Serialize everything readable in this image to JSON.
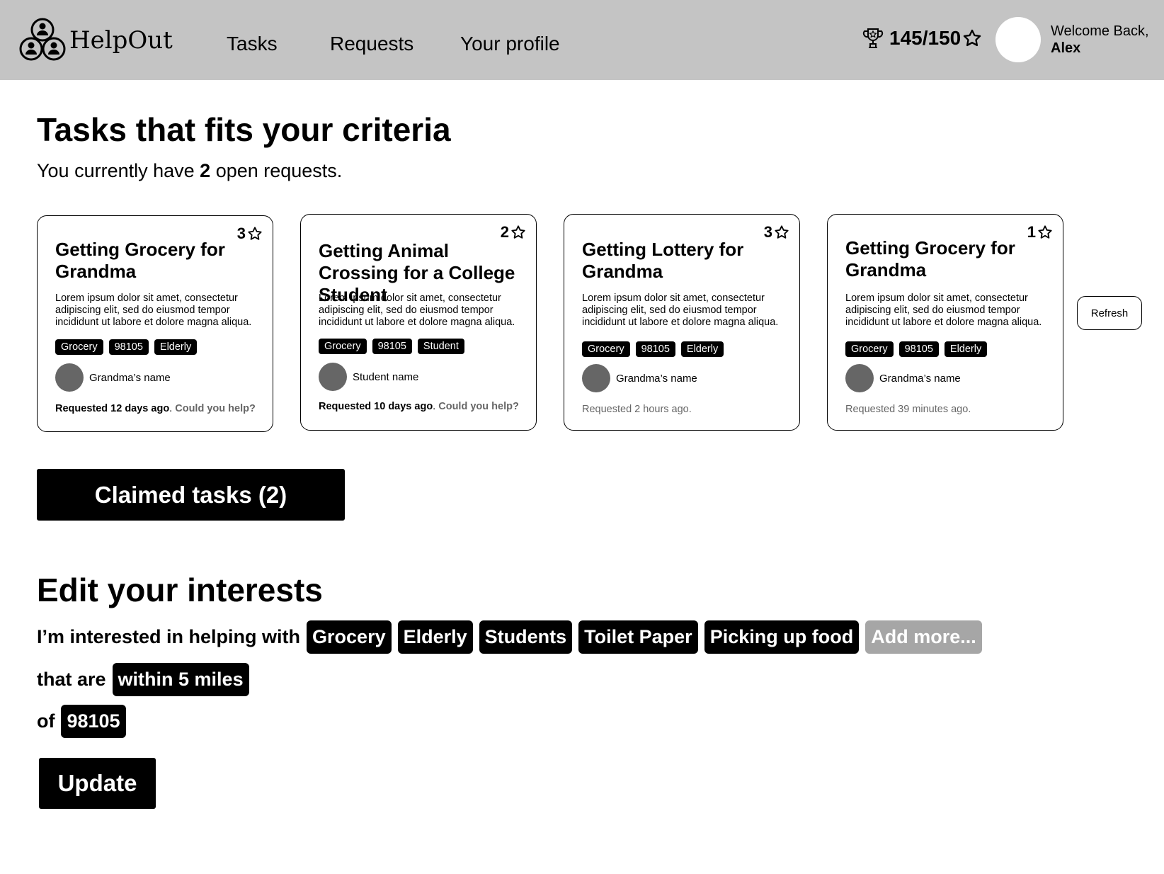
{
  "header": {
    "logo_text": "HelpOut",
    "nav": [
      "Tasks",
      "Requests",
      "Your profile"
    ],
    "score": "145/150",
    "welcome": "Welcome Back,",
    "user_name": "Alex"
  },
  "tasks": {
    "title": "Tasks that fits your criteria",
    "open_prefix": "You currently have ",
    "open_count": "2",
    "open_suffix": " open requests.",
    "cards": [
      {
        "stars": "3",
        "title": "Getting Grocery for Grandma",
        "desc": "Lorem ipsum dolor sit amet, consectetur adipiscing elit, sed do eiusmod tempor incididunt ut labore et dolore magna aliqua.",
        "tags": [
          "Grocery",
          "98105",
          "Elderly"
        ],
        "person": "Grandma’s name",
        "requested": "Requested 12 days ago",
        "help": "Could you help?"
      },
      {
        "stars": "2",
        "title": "Getting Animal Crossing for a College Student",
        "desc": "Lorem ipsum dolor sit amet, consectetur adipiscing elit, sed do eiusmod tempor incididunt ut labore et dolore magna aliqua.",
        "tags": [
          "Grocery",
          "98105",
          "Student"
        ],
        "person": "Student name",
        "requested": "Requested 10 days ago",
        "help": "Could you help?"
      },
      {
        "stars": "3",
        "title": "Getting Lottery for Grandma",
        "desc": "Lorem ipsum dolor sit amet, consectetur adipiscing elit, sed do eiusmod tempor incididunt ut labore et dolore magna aliqua.",
        "tags": [
          "Grocery",
          "98105",
          "Elderly"
        ],
        "person": "Grandma’s name",
        "requested_plain": "Requested 2 hours ago."
      },
      {
        "stars": "1",
        "title": "Getting Grocery for Grandma",
        "desc": "Lorem ipsum dolor sit amet, consectetur adipiscing elit, sed do eiusmod tempor incididunt ut labore et dolore magna aliqua.",
        "tags": [
          "Grocery",
          "98105",
          "Elderly"
        ],
        "person": "Grandma’s name",
        "requested_plain": "Requested 39 minutes ago."
      }
    ],
    "refresh": "Refresh",
    "claimed": "Claimed tasks (2)"
  },
  "interests": {
    "title": "Edit your interests",
    "line1_label": "I’m interested in helping with",
    "chips": [
      "Grocery",
      "Elderly",
      "Students",
      "Toilet Paper",
      "Picking up food"
    ],
    "add_more": "Add more...",
    "line2_label": "that are",
    "distance": "within 5 miles",
    "line3_label": "of",
    "zip": "98105",
    "update": "Update"
  }
}
